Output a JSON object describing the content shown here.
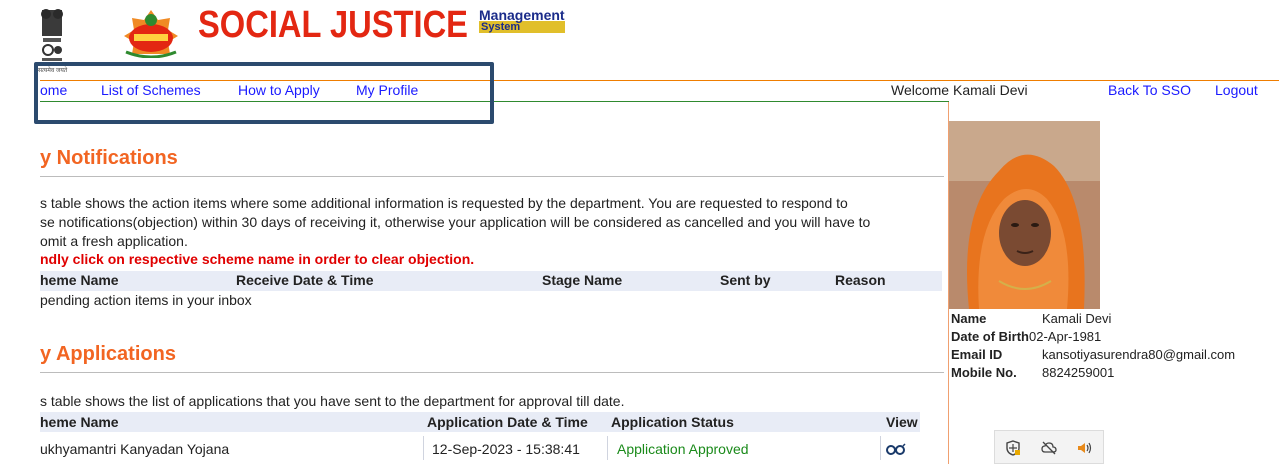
{
  "header": {
    "brand_title": "SOCIAL JUSTICE",
    "brand_sub_top": "Management",
    "brand_sub_bottom": "System",
    "emblem_caption": "सत्यमेव जयते"
  },
  "nav": {
    "items": [
      {
        "label": "ome"
      },
      {
        "label": "List of Schemes"
      },
      {
        "label": "How to Apply"
      },
      {
        "label": "My Profile"
      }
    ],
    "welcome": "Welcome Kamali Devi",
    "back_to_sso": "Back To SSO",
    "logout": "Logout"
  },
  "notifications": {
    "heading": "y Notifications",
    "desc_line1": "s table shows the action items where some additional information is requested by the department. You are requested to respond to",
    "desc_line2": "se notifications(objection) within 30 days of receiving it, otherwise your application will be considered as cancelled and you will have to",
    "desc_line3": "omit a fresh application.",
    "note": "ndly click on respective scheme name in order to clear objection.",
    "columns": [
      "heme Name",
      "Receive Date & Time",
      "Stage Name",
      "Sent by",
      "Reason"
    ],
    "empty_text": " pending action items in your inbox"
  },
  "applications": {
    "heading": "y Applications",
    "desc": "s table shows the list of applications that you have sent to the department for approval till date.",
    "columns": [
      "heme Name",
      "Application Date & Time",
      "Application Status",
      "View"
    ],
    "rows": [
      {
        "scheme": "ukhyamantri Kanyadan Yojana",
        "date": "12-Sep-2023 - 15:38:41",
        "status": "Application Approved"
      }
    ]
  },
  "profile": {
    "name_label": "Name",
    "name_value": "Kamali Devi",
    "dob_label": "Date of Birth",
    "dob_value": "02-Apr-1981",
    "email_label": "Email ID",
    "email_value": "kansotiyasurendra80@gmail.com",
    "mobile_label": "Mobile No.",
    "mobile_value": "8824259001"
  },
  "colors": {
    "brand_red": "#e32712",
    "heading_orange": "#f26522",
    "link_blue": "#1a1aff",
    "approved_green": "#1a8a1a",
    "highlight_box": "#2b4a6e"
  },
  "icons": {
    "view": "spectacles-icon",
    "taskbar": [
      "shield-icon",
      "cloud-off-icon",
      "speaker-icon"
    ]
  }
}
